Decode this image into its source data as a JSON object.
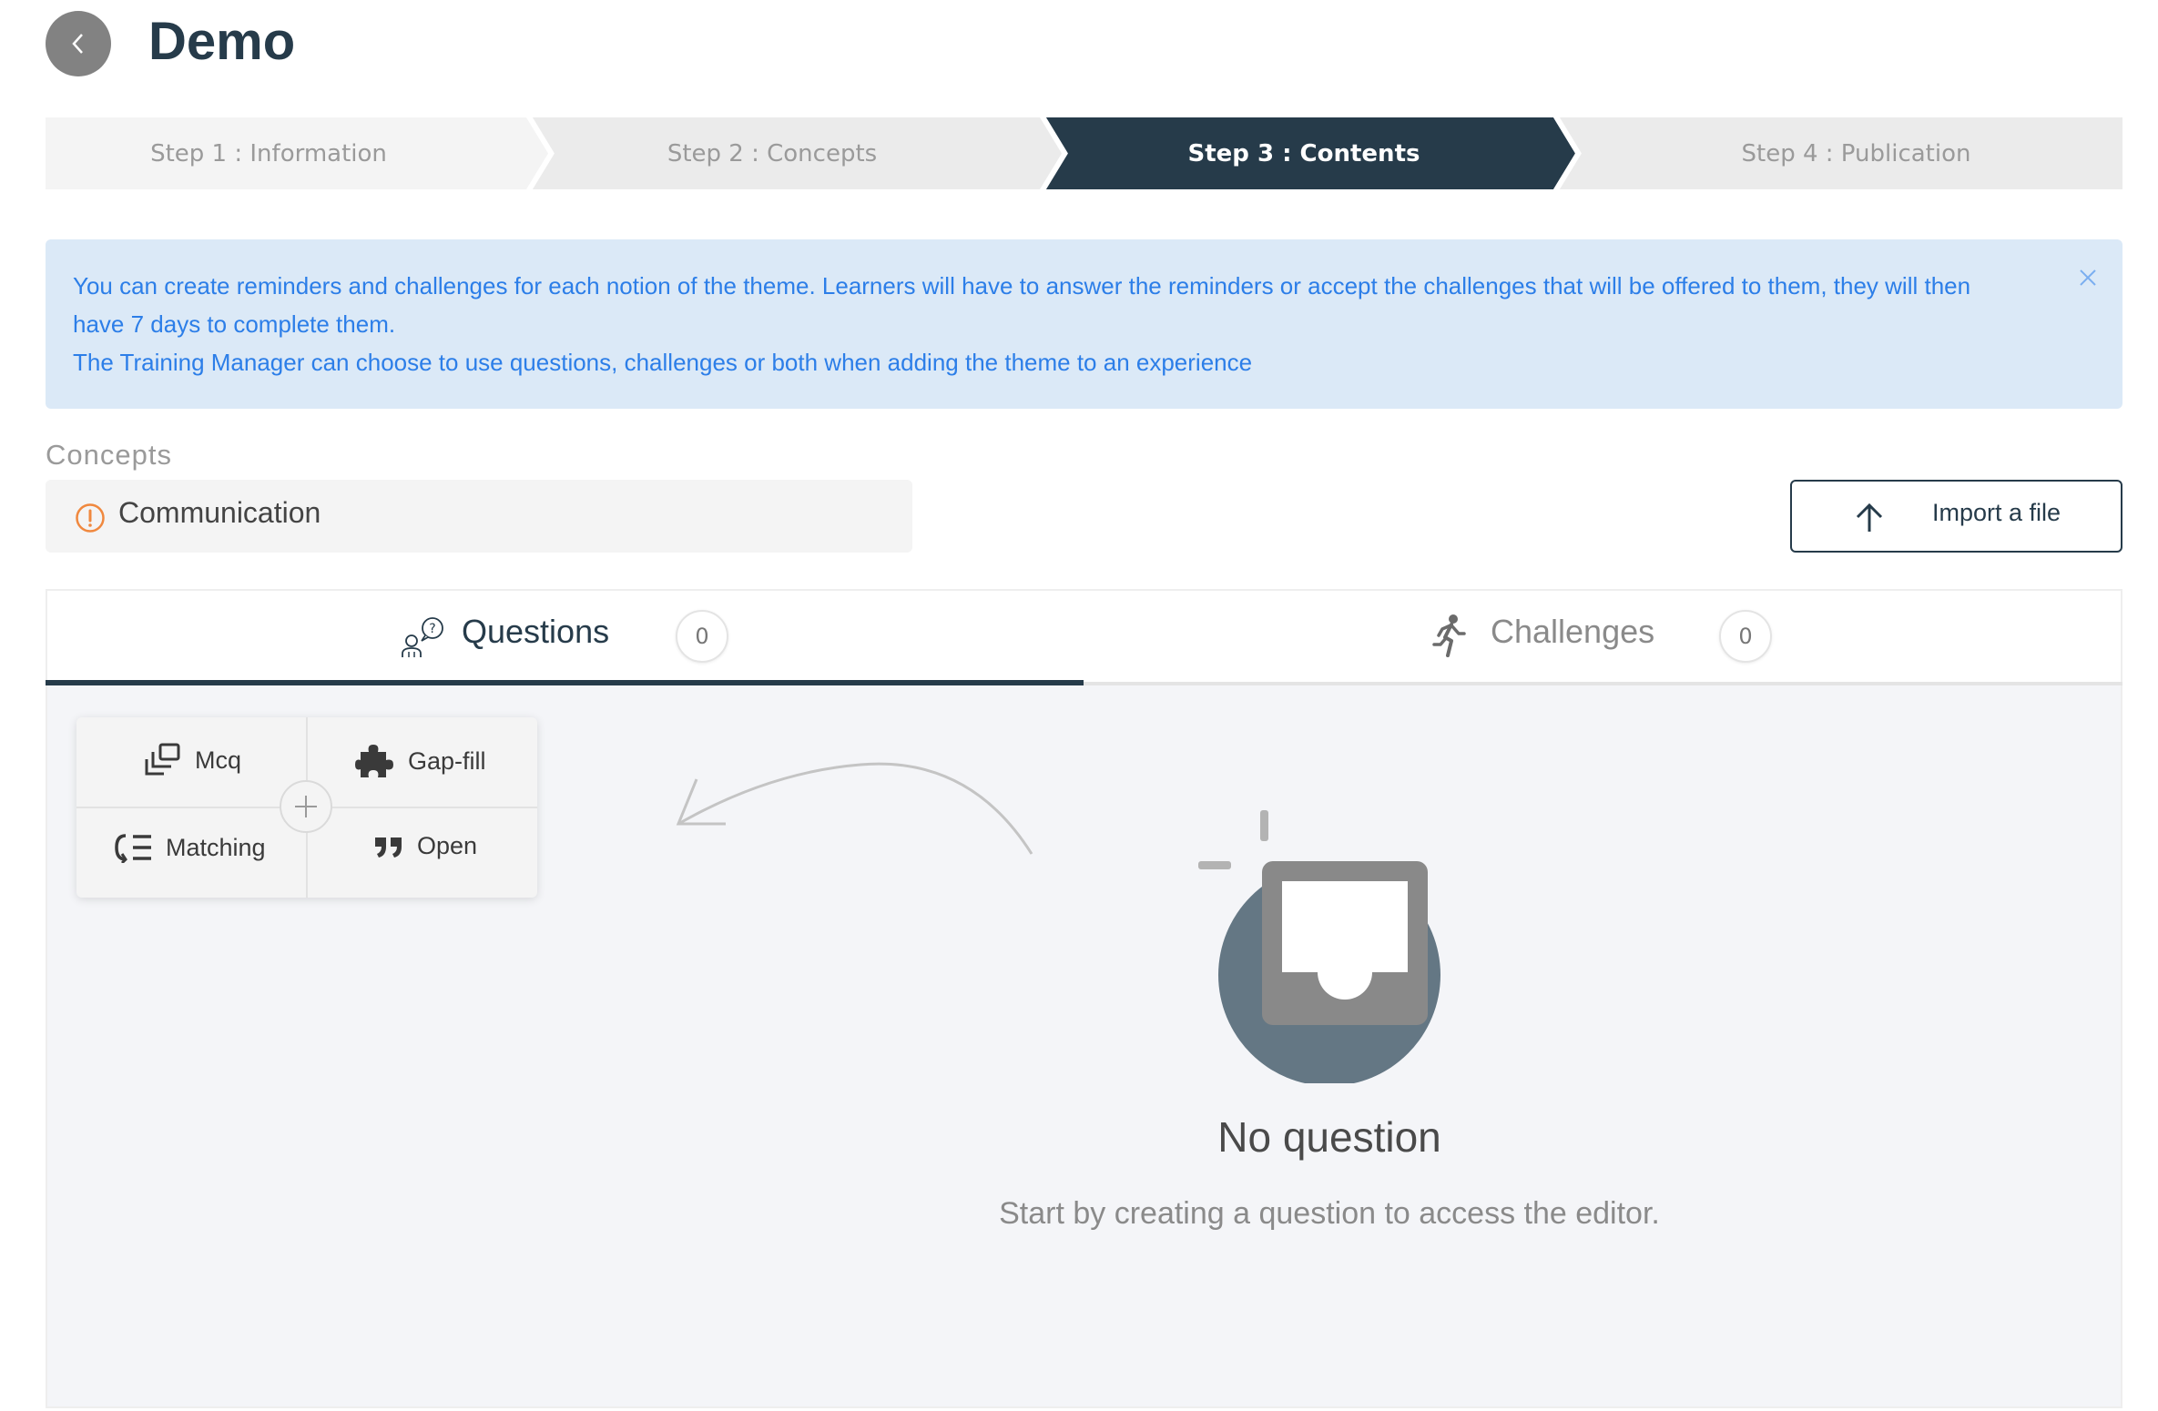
{
  "header": {
    "title": "Demo"
  },
  "stepper": {
    "steps": [
      {
        "label": "Step 1 : Information",
        "state": "done"
      },
      {
        "label": "Step 2 : Concepts",
        "state": "done"
      },
      {
        "label": "Step 3 : Contents",
        "state": "active"
      },
      {
        "label": "Step 4 : Publication",
        "state": "todo"
      }
    ],
    "active_color": "#263b4a",
    "inactive_colors": [
      "#f4f4f4",
      "#ebebeb",
      "#263b4a",
      "#ebebeb"
    ]
  },
  "alert": {
    "line1": "You can create reminders and challenges for each notion of the theme. Learners will have to answer the reminders or accept the challenges that will be offered to them, they will then",
    "line2": "have 7 days to complete them.",
    "line3": "The Training Manager can choose to use questions, challenges or both when adding the theme to an experience",
    "background": "#dbe9f7",
    "text_color": "#2c7ee8"
  },
  "concepts": {
    "label": "Concepts",
    "selected": "Communication",
    "warning_color": "#f0883e"
  },
  "import": {
    "label": "Import a file"
  },
  "tabs": {
    "questions": {
      "label": "Questions",
      "count": "0",
      "active": true
    },
    "challenges": {
      "label": "Challenges",
      "count": "0",
      "active": false
    }
  },
  "picker": {
    "items": [
      {
        "label": "Mcq",
        "icon": "mcq-icon"
      },
      {
        "label": "Gap-fill",
        "icon": "puzzle-icon"
      },
      {
        "label": "Matching",
        "icon": "matching-icon"
      },
      {
        "label": "Open",
        "icon": "quote-icon"
      }
    ]
  },
  "empty": {
    "title": "No question",
    "subtitle": "Start by creating a question to access the editor."
  }
}
